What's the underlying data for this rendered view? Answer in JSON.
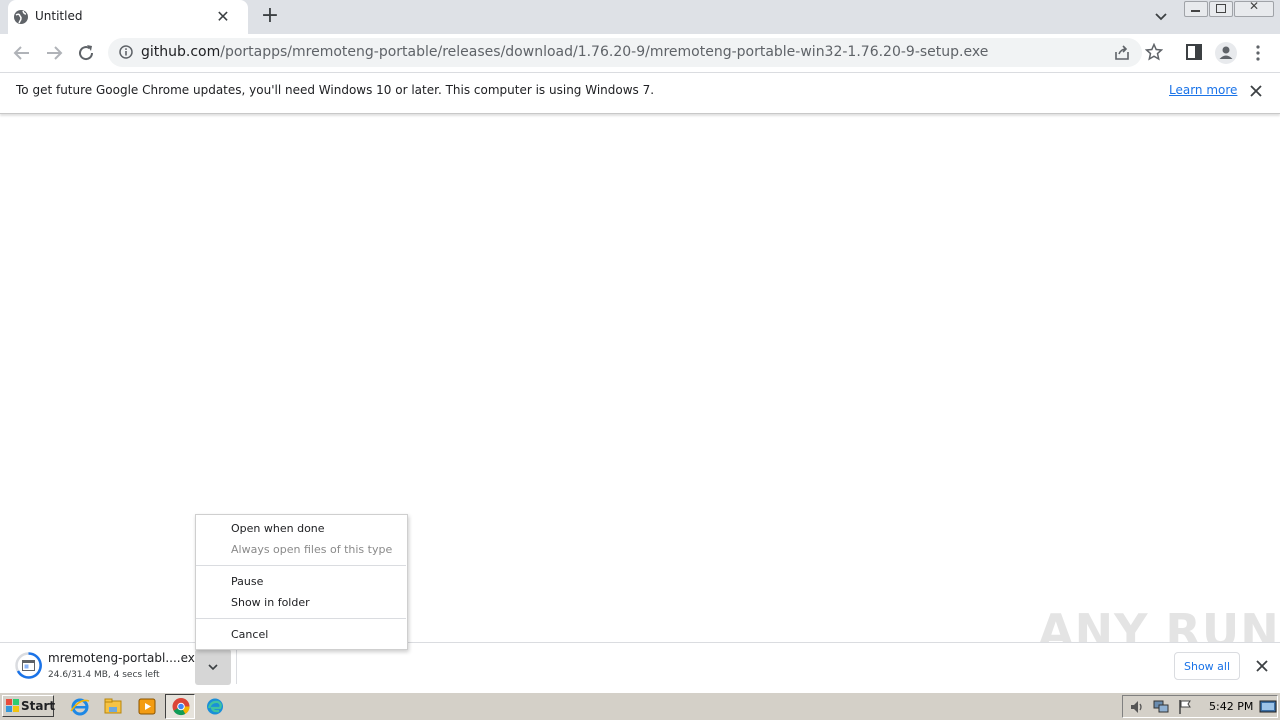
{
  "browser": {
    "tab": {
      "title": "Untitled"
    },
    "address": {
      "host": "github.com",
      "path": "/portapps/mremoteng-portable/releases/download/1.76.20-9/mremoteng-portable-win32-1.76.20-9-setup.exe"
    },
    "infobar": {
      "message": "To get future Google Chrome updates, you'll need Windows 10 or later. This computer is using Windows 7.",
      "learn_more": "Learn more"
    }
  },
  "context_menu": {
    "items": [
      {
        "label": "Open when done",
        "enabled": true
      },
      {
        "label": "Always open files of this type",
        "enabled": false
      },
      {
        "label": "Pause",
        "enabled": true
      },
      {
        "label": "Show in folder",
        "enabled": true
      },
      {
        "label": "Cancel",
        "enabled": true
      }
    ]
  },
  "download": {
    "filename": "mremoteng-portabl....exe",
    "status": "24.6/31.4 MB, 4 secs left",
    "show_all": "Show all"
  },
  "watermark": "ANY RUN",
  "taskbar": {
    "start_label": "Start",
    "clock": "5:42 PM",
    "apps": [
      "ie-icon",
      "explorer-icon",
      "media-player-icon",
      "chrome-icon",
      "edge-icon"
    ]
  },
  "colors": {
    "tabstrip": "#dee1e6",
    "link": "#1a73e8",
    "taskbar": "#d4d0c8"
  }
}
